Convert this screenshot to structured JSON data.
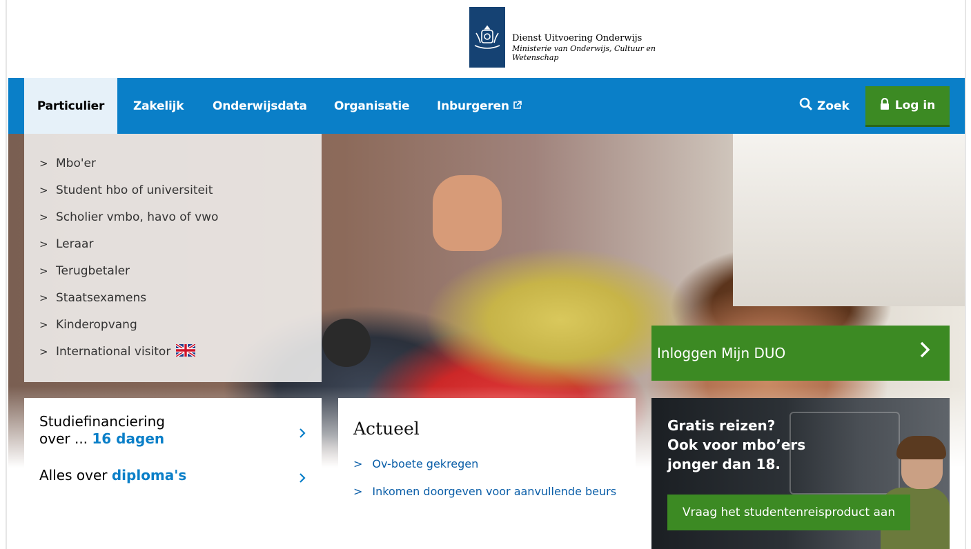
{
  "header": {
    "logo_line1": "Dienst Uitvoering Onderwijs",
    "logo_line2": "Ministerie van Onderwijs, Cultuur en",
    "logo_line3": "Wetenschap"
  },
  "nav": {
    "items": [
      {
        "label": "Particulier",
        "active": true
      },
      {
        "label": "Zakelijk"
      },
      {
        "label": "Onderwijsdata"
      },
      {
        "label": "Organisatie"
      },
      {
        "label": "Inburgeren",
        "icon": "external-link-icon"
      }
    ],
    "search_label": "Zoek",
    "login_label": "Log in"
  },
  "menu": {
    "items": [
      "Mbo'er",
      "Student hbo of universiteit",
      "Scholier vmbo, havo of vwo",
      "Leraar",
      "Terugbetaler",
      "Staatsexamens",
      "Kinderopvang",
      "International visitor"
    ]
  },
  "mijnduo": {
    "label": "Inloggen Mijn DUO"
  },
  "links": {
    "studiefinanciering_line1": "Studiefinanciering",
    "studiefinanciering_prefix": "over ... ",
    "studiefinanciering_days": "16 dagen",
    "diplomas_prefix": "Alles over ",
    "diplomas_highlight": "diploma's"
  },
  "actueel": {
    "title": "Actueel",
    "items": [
      "Ov-boete gekregen",
      "Inkomen doorgeven voor aanvullende beurs"
    ]
  },
  "promo": {
    "line1": "Gratis reizen?",
    "line2": "Ook voor mbo’ers",
    "line3": "jonger dan 18.",
    "button_label": "Vraag het studentenreisproduct aan"
  },
  "colors": {
    "nav_blue": "#0a7fc8",
    "logo_blue": "#154273",
    "green": "#3c8a23"
  }
}
